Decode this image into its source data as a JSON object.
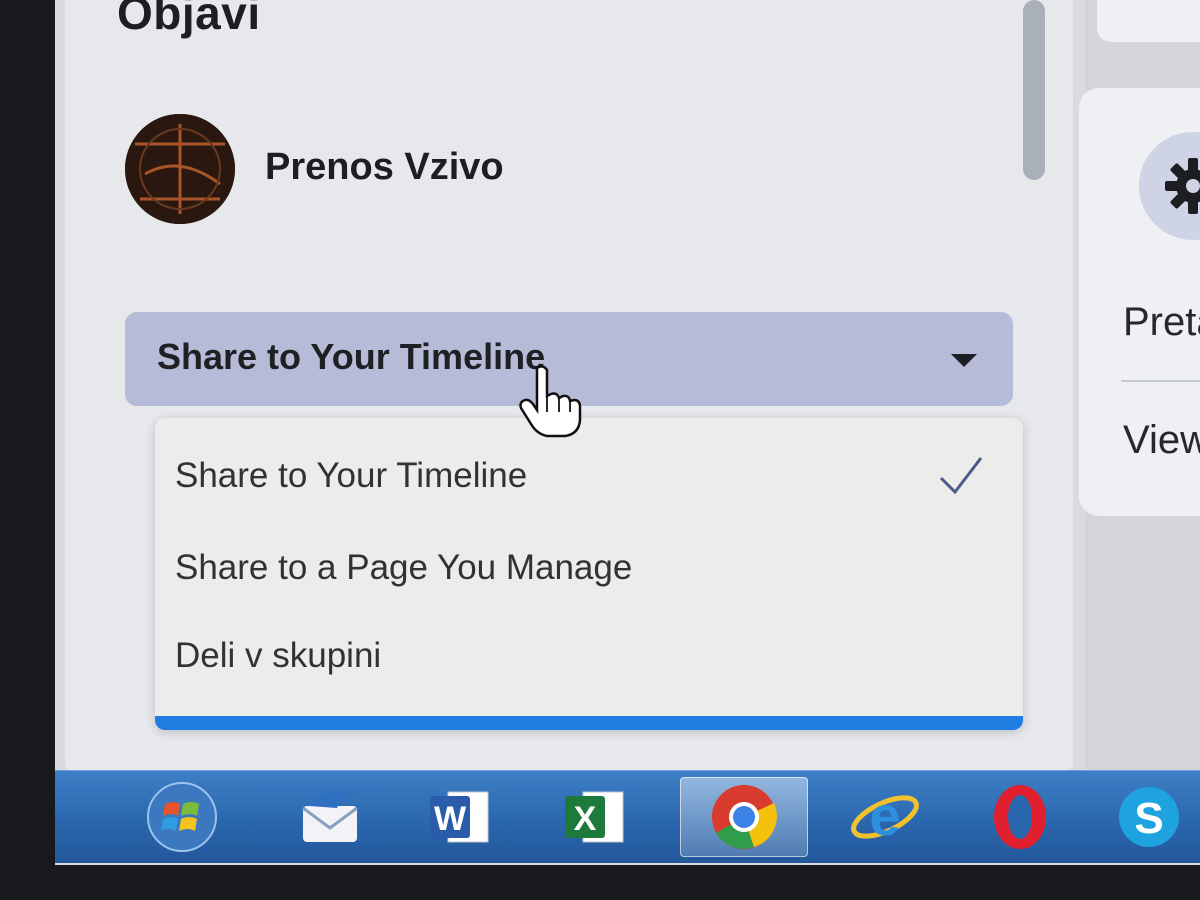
{
  "panel": {
    "heading": "Objavi",
    "profile": {
      "name": "Prenos Vzivo"
    },
    "share_select": {
      "selected": "Share to Your Timeline"
    },
    "share_menu": {
      "items": [
        {
          "label": "Share to Your Timeline",
          "selected": true
        },
        {
          "label": "Share to a Page You Manage",
          "selected": false
        },
        {
          "label": "Deli v skupini",
          "selected": false
        }
      ]
    }
  },
  "right_panel": {
    "settings_icon": "gear-icon",
    "item_1": "Preta",
    "item_2": "Viewi"
  },
  "taskbar": {
    "items": [
      {
        "name": "start",
        "icon": "windows-start-icon"
      },
      {
        "name": "thunderbird",
        "icon": "thunderbird-icon"
      },
      {
        "name": "word",
        "icon": "word-icon",
        "glyph": "W"
      },
      {
        "name": "excel",
        "icon": "excel-icon",
        "glyph": "X"
      },
      {
        "name": "chrome",
        "icon": "chrome-icon",
        "active": true
      },
      {
        "name": "internet-explorer",
        "icon": "ie-icon",
        "glyph": "e"
      },
      {
        "name": "opera",
        "icon": "opera-icon"
      },
      {
        "name": "skype",
        "icon": "skype-icon",
        "glyph": "S"
      }
    ]
  },
  "colors": {
    "select_bg": "#b6bbd8",
    "menu_accent": "#1f7ce0",
    "taskbar": "#2a67ae",
    "check": "#4a5a8a"
  }
}
